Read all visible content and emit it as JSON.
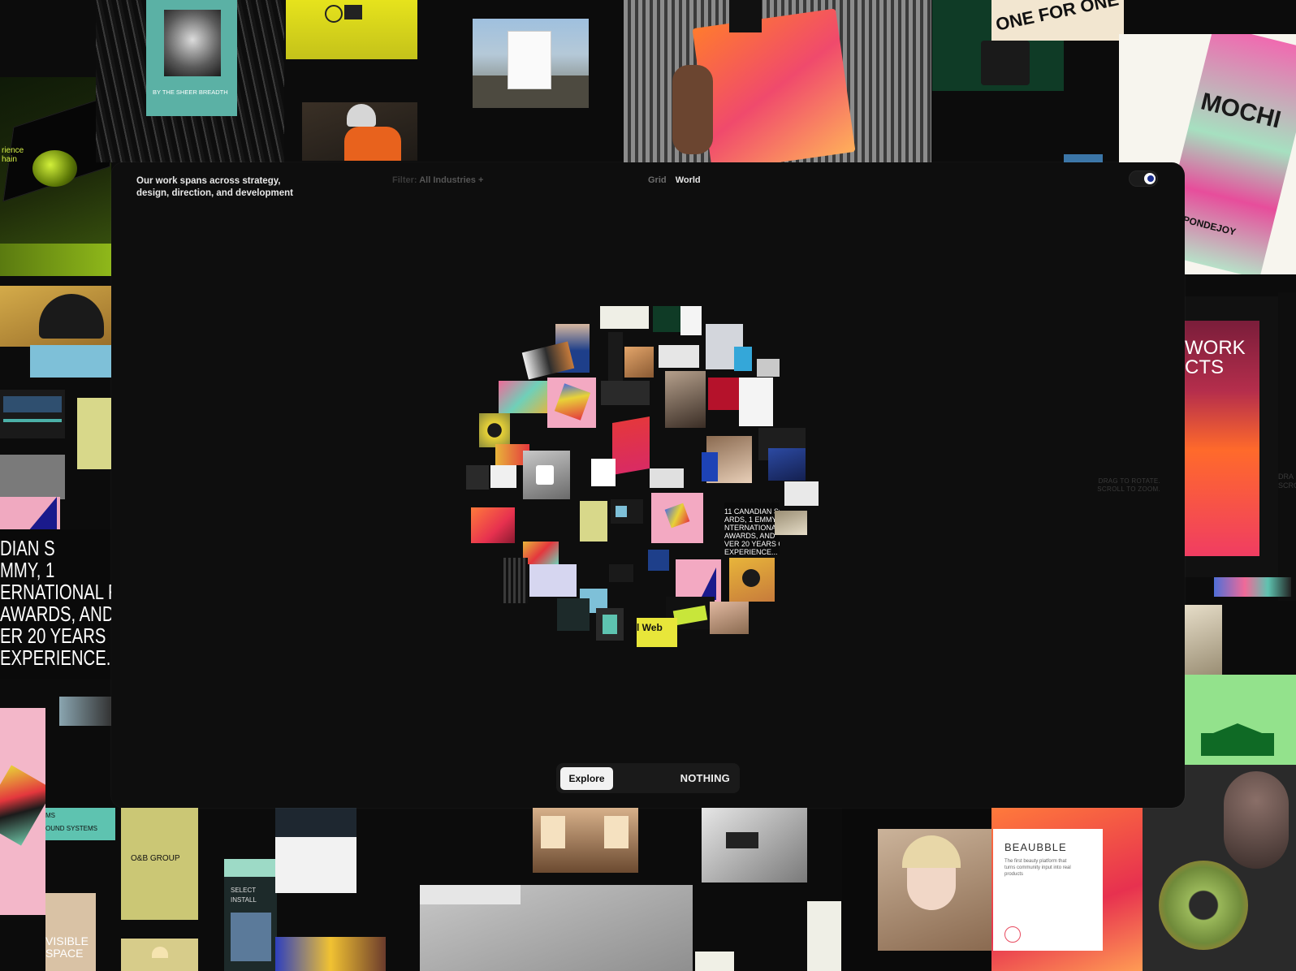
{
  "header": {
    "tagline": "Our work spans across strategy, design, direction, and development",
    "filter_label": "Filter:",
    "filter_value": "All Industries +",
    "view_grid": "Grid",
    "view_world": "World",
    "theme_toggle_icon": "moon-icon"
  },
  "hint": {
    "line1": "DRAG TO ROTATE.",
    "line2": "SCROLL TO ZOOM."
  },
  "bottom_bar": {
    "explore_label": "Explore",
    "brand": "NOTHING"
  },
  "background_text": {
    "sheer_breadth": "BY THE SHEER BREADTH",
    "one_for_one": "ONE FOR ONE",
    "mochi": "MOCHI",
    "work_projects": "WORK\nCTS",
    "canadian_awards": "DIAN S\nMMY, 1\nERNATIONAL F\nAWARDS, AND\nER 20 YEARS\nEXPERIENCE...",
    "visible_space": "VISIBLE\nSPACE",
    "ob_group": "O&B GROUP",
    "sound_systems": "MS\nOUND SYSTEMS",
    "select_install": "SELECT\nINSTALL",
    "beaubble_title": "BEAUBBLE",
    "beaubble_body": "The first beauty platform that turns community input into real products",
    "experience_chain": "rience\nhain",
    "pondejoy": "PONDEJOY",
    "drag_right": "DRA\nSCRO"
  },
  "globe_text": {
    "awards": "11 CANADIAN SC\nARDS, 1 EMMY, 1\nNTERNATIONAL FI\nAWARDS, AND\nVER 20 YEARS O\nEXPERIENCE...",
    "web": "l Web"
  },
  "colors": {
    "page_bg": "#0c0c0c",
    "panel_bg": "#0e0e0e",
    "accent_blue": "#1c2f8f"
  }
}
